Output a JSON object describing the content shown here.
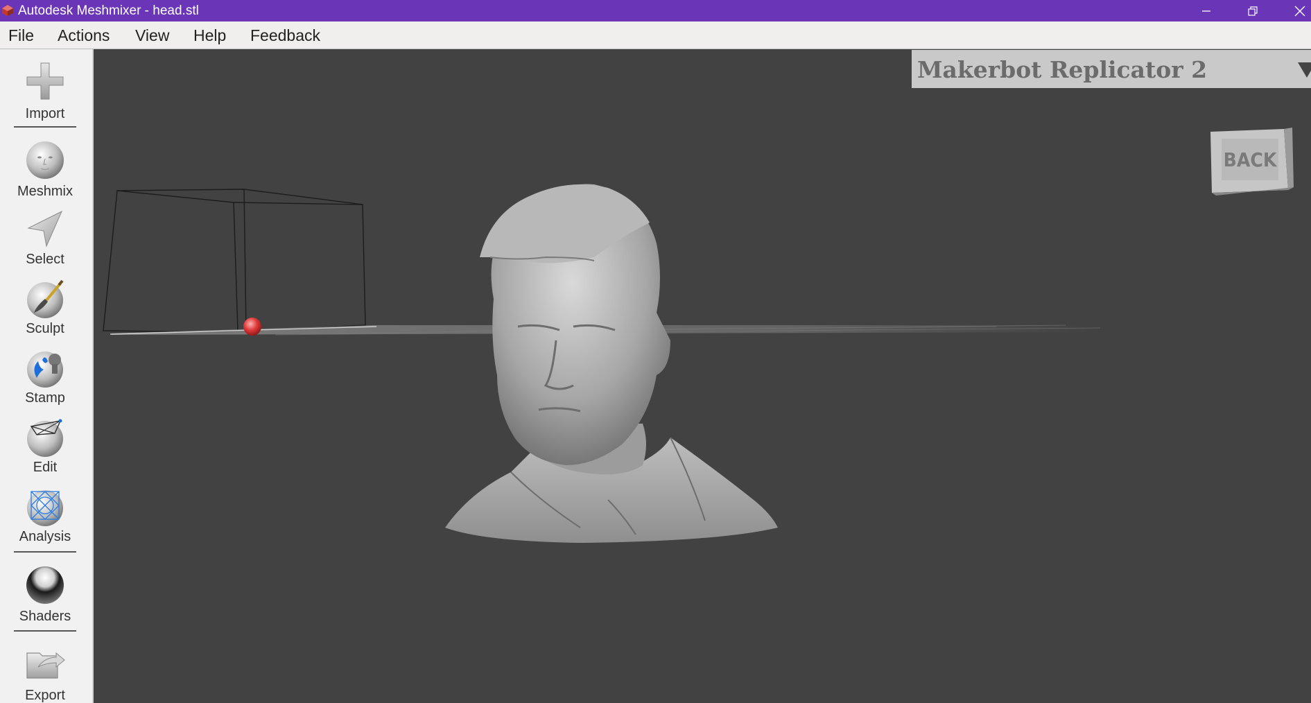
{
  "window": {
    "title": "Autodesk Meshmixer - head.stl",
    "minimize_icon": "minimize-icon",
    "maximize_icon": "restore-icon",
    "close_icon": "close-icon"
  },
  "menu": {
    "items": [
      "File",
      "Actions",
      "View",
      "Help",
      "Feedback"
    ]
  },
  "toolbar": {
    "tools": [
      {
        "label": "Import",
        "icon": "plus-icon"
      },
      {
        "label": "Meshmix",
        "icon": "face-sphere-icon"
      },
      {
        "label": "Select",
        "icon": "arrow-cursor-icon"
      },
      {
        "label": "Sculpt",
        "icon": "brush-sphere-icon"
      },
      {
        "label": "Stamp",
        "icon": "stamp-sphere-icon"
      },
      {
        "label": "Edit",
        "icon": "wireframe-sphere-icon"
      },
      {
        "label": "Analysis",
        "icon": "mesh-sphere-icon"
      },
      {
        "label": "Shaders",
        "icon": "chrome-sphere-icon"
      },
      {
        "label": "Export",
        "icon": "export-folder-icon"
      }
    ]
  },
  "printer": {
    "name": "Makerbot Replicator 2",
    "dropdown_icon": "chevron-down-icon"
  },
  "viewcube": {
    "face_label": "BACK"
  },
  "colors": {
    "titlebar": "#6a35b7",
    "viewport": "#424242",
    "toolbar": "#f1f1f1",
    "printer_panel": "#c9c9c9",
    "pivot": "#e03b3b"
  }
}
